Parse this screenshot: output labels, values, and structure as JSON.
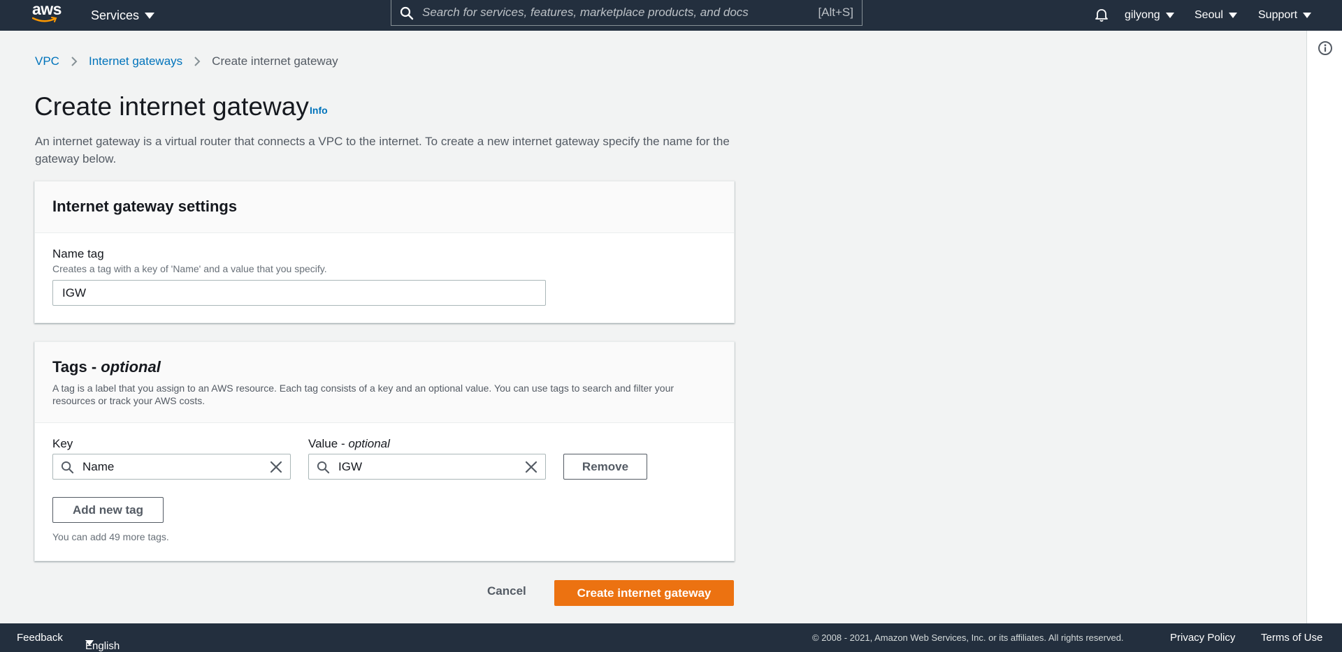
{
  "topnav": {
    "logo_text": "aws",
    "services_label": "Services",
    "search_placeholder": "Search for services, features, marketplace products, and docs",
    "search_shortcut": "[Alt+S]",
    "user": "gilyong",
    "region": "Seoul",
    "support": "Support"
  },
  "breadcrumb": {
    "items": [
      "VPC",
      "Internet gateways",
      "Create internet gateway"
    ]
  },
  "page": {
    "title": "Create internet gateway",
    "info": "Info",
    "description": "An internet gateway is a virtual router that connects a VPC to the internet. To create a new internet gateway specify the name for the gateway below."
  },
  "settings_panel": {
    "title": "Internet gateway settings",
    "name_tag_label": "Name tag",
    "name_tag_hint": "Creates a tag with a key of 'Name' and a value that you specify.",
    "name_tag_value": "IGW"
  },
  "tags_panel": {
    "title": "Tags - ",
    "title_optional": "optional",
    "description": "A tag is a label that you assign to an AWS resource. Each tag consists of a key and an optional value. You can use tags to search and filter your resources or track your AWS costs.",
    "key_label": "Key",
    "value_label": "Value - ",
    "value_label_optional": "optional",
    "key_value": "Name",
    "value_value": "IGW",
    "remove_label": "Remove",
    "add_label": "Add new tag",
    "remaining": "You can add 49 more tags."
  },
  "actions": {
    "cancel": "Cancel",
    "create": "Create internet gateway"
  },
  "footer": {
    "feedback": "Feedback",
    "language": "English (US)",
    "copyright": "© 2008 - 2021, Amazon Web Services, Inc. or its affiliates. All rights reserved.",
    "privacy": "Privacy Policy",
    "terms": "Terms of Use"
  },
  "colors": {
    "nav_bg": "#232f3e",
    "link": "#0073bb",
    "primary": "#ec7211",
    "logo_smile": "#ff9900"
  }
}
